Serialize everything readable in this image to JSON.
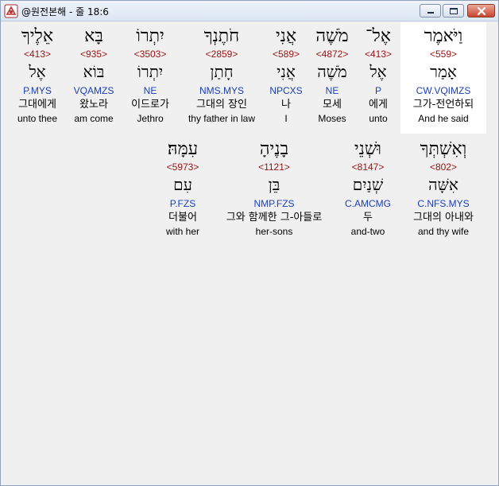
{
  "window": {
    "title": "@원전본해 - 줄 18:6"
  },
  "rows": [
    {
      "words": [
        {
          "hebrew": "וַיֹּאמֶר",
          "strong": "<559>",
          "root": "אָמַר",
          "parse": "CW.VQIMZS",
          "korean": "그가-전언하되",
          "english": "And he said",
          "highlighted": true
        },
        {
          "hebrew": "אֶל־",
          "strong": "<413>",
          "root": "אֶל",
          "parse": "P",
          "korean": "에게",
          "english": "unto"
        },
        {
          "hebrew": "מֹשֶׁה",
          "strong": "<4872>",
          "root": "מֹשֶׁה",
          "parse": "NE",
          "korean": "모세",
          "english": "Moses"
        },
        {
          "hebrew": "אֲנִי",
          "strong": "<589>",
          "root": "אֲנִי",
          "parse": "NPCXS",
          "korean": "나",
          "english": "I"
        },
        {
          "hebrew": "חֹתֶנְךָ",
          "strong": "<2859>",
          "root": "חָתַן",
          "parse": "NMS.MYS",
          "korean": "그대의 장인",
          "english": "thy father in law"
        },
        {
          "hebrew": "יִתְרוֹ",
          "strong": "<3503>",
          "root": "יִתְרוֹ",
          "parse": "NE",
          "korean": "이드로가",
          "english": "Jethro"
        },
        {
          "hebrew": "בָּא",
          "strong": "<935>",
          "root": "בּוֹא",
          "parse": "VQAMZS",
          "korean": "왔노라",
          "english": "am come"
        },
        {
          "hebrew": "אֵלֶיךָ",
          "strong": "<413>",
          "root": "אֶל",
          "parse": "P.MYS",
          "korean": "그대에게",
          "english": "unto thee"
        }
      ]
    },
    {
      "words": [
        {
          "hebrew": "וְאִשְׁתְּךָ",
          "strong": "<802>",
          "root": "אִשָּׁה",
          "parse": "C.NFS.MYS",
          "korean": "그대의 아내와",
          "english": "and thy wife"
        },
        {
          "hebrew": "וּשְׁנֵי",
          "strong": "<8147>",
          "root": "שְׁנַיִם",
          "parse": "C.AMCMG",
          "korean": "두",
          "english": "and-two"
        },
        {
          "hebrew": "בָנֶיהָ",
          "strong": "<1121>",
          "root": "בֵּן",
          "parse": "NMP.FZS",
          "korean": "그와 함께한 그-아들로",
          "english": "her-sons"
        },
        {
          "hebrew": "עִמָּהּ׃",
          "strong": "<5973>",
          "root": "עִם",
          "parse": "P.FZS",
          "korean": "더불어",
          "english": "with her"
        }
      ]
    }
  ]
}
